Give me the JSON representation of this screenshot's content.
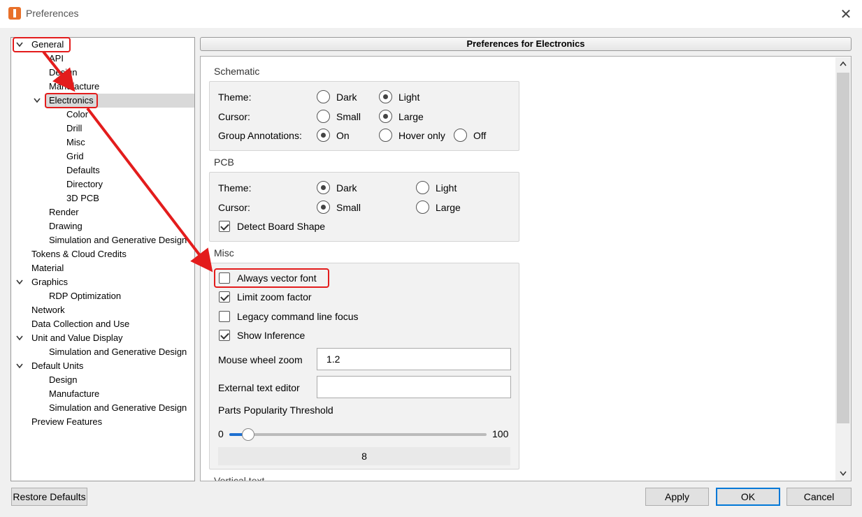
{
  "window": {
    "title": "Preferences",
    "close_glyph": "✕"
  },
  "tree": {
    "items": [
      {
        "label": "General"
      },
      {
        "label": "API"
      },
      {
        "label": "Design"
      },
      {
        "label": "Manufacture"
      },
      {
        "label": "Electronics"
      },
      {
        "label": "Color"
      },
      {
        "label": "Drill"
      },
      {
        "label": "Misc"
      },
      {
        "label": "Grid"
      },
      {
        "label": "Defaults"
      },
      {
        "label": "Directory"
      },
      {
        "label": "3D PCB"
      },
      {
        "label": "Render"
      },
      {
        "label": "Drawing"
      },
      {
        "label": "Simulation and Generative Design"
      },
      {
        "label": "Tokens & Cloud Credits"
      },
      {
        "label": "Material"
      },
      {
        "label": "Graphics"
      },
      {
        "label": "RDP Optimization"
      },
      {
        "label": "Network"
      },
      {
        "label": "Data Collection and Use"
      },
      {
        "label": "Unit and Value Display"
      },
      {
        "label": "Simulation and Generative Design"
      },
      {
        "label": "Default Units"
      },
      {
        "label": "Design"
      },
      {
        "label": "Manufacture"
      },
      {
        "label": "Simulation and Generative Design"
      },
      {
        "label": "Preview Features"
      }
    ]
  },
  "panel": {
    "header": "Preferences for Electronics",
    "schematic": {
      "title": "Schematic",
      "theme_label": "Theme:",
      "theme_dark": "Dark",
      "theme_light": "Light",
      "cursor_label": "Cursor:",
      "cursor_small": "Small",
      "cursor_large": "Large",
      "group_label": "Group Annotations:",
      "group_on": "On",
      "group_hover": "Hover only",
      "group_off": "Off"
    },
    "pcb": {
      "title": "PCB",
      "theme_label": "Theme:",
      "theme_dark": "Dark",
      "theme_light": "Light",
      "cursor_label": "Cursor:",
      "cursor_small": "Small",
      "cursor_large": "Large",
      "detect_board_shape": "Detect Board Shape"
    },
    "misc": {
      "title": "Misc",
      "always_vector_font": "Always vector font",
      "limit_zoom_factor": "Limit zoom factor",
      "legacy_command_line_focus": "Legacy command line focus",
      "show_inference": "Show Inference",
      "mouse_wheel_zoom_label": "Mouse wheel zoom",
      "mouse_wheel_zoom_value": "1.2",
      "external_text_editor_label": "External text editor",
      "external_text_editor_value": "",
      "parts_popularity_label": "Parts Popularity Threshold",
      "slider_min": "0",
      "slider_max": "100",
      "slider_value": "8"
    },
    "next_section_partial": "Vertical text"
  },
  "buttons": {
    "restore_defaults": "Restore Defaults",
    "apply": "Apply",
    "ok": "OK",
    "cancel": "Cancel"
  },
  "state": {
    "schematic_theme": "Light",
    "schematic_cursor": "Large",
    "schematic_group_annotations": "On",
    "pcb_theme": "Dark",
    "pcb_cursor": "Small",
    "detect_board_shape": true,
    "always_vector_font": false,
    "limit_zoom_factor": true,
    "legacy_command_line_focus": false,
    "show_inference": true,
    "slider_fraction": 0.08
  },
  "colors": {
    "annotation": "#e31c1c",
    "accent": "#0078d7",
    "slider_fill": "#1d6fd0"
  }
}
